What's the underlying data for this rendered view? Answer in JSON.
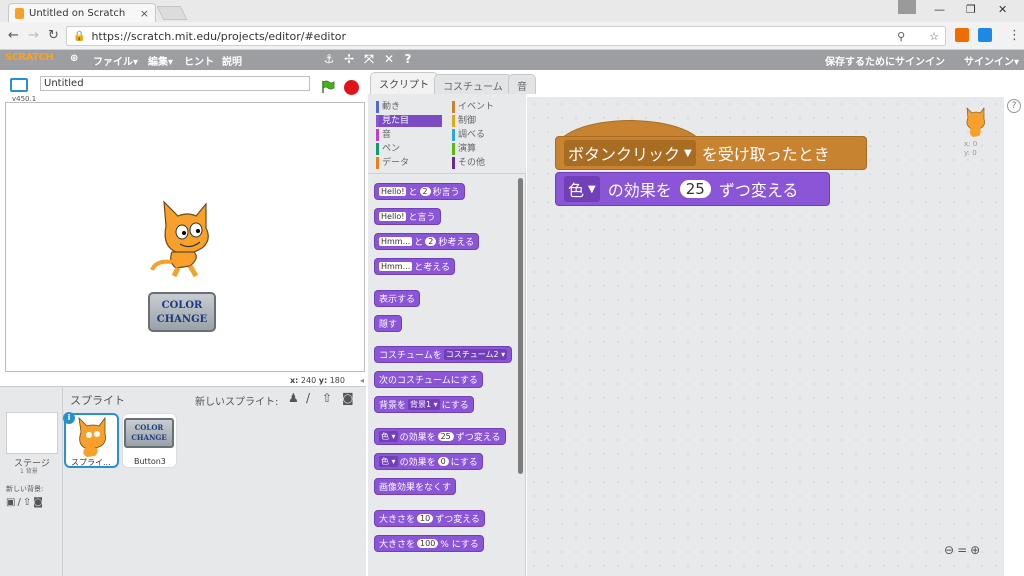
{
  "browser": {
    "tab_title": "Untitled on Scratch",
    "tab_close": "×",
    "url": "https://scratch.mit.edu/projects/editor/#editor",
    "window_controls": [
      "—",
      "❐",
      "✕"
    ]
  },
  "menubar": {
    "logo": "SCRATCH",
    "items": [
      "ファイル▾",
      "編集▾",
      "ヒント",
      "説明"
    ],
    "sign_in_to_save": "保存するためにサインイン",
    "sign_in": "サインイン▾"
  },
  "stage": {
    "version": "v450.1",
    "project_title": "Untitled",
    "coords_x_label": "x:",
    "coords_x": "240",
    "coords_y_label": "y:",
    "coords_y": "180",
    "button_text_line1": "COLOR",
    "button_text_line2": "CHANGE"
  },
  "sprites": {
    "title": "スプライト",
    "new_sprite": "新しいスプライト:",
    "stage_label": "ステージ",
    "stage_sub": "1 背景",
    "new_backdrop": "新しい背景:",
    "sprite1_name": "スプライ...",
    "button3_name": "Button3"
  },
  "tabs": {
    "scripts": "スクリプト",
    "costumes": "コスチューム",
    "sounds": "音"
  },
  "categories": [
    {
      "label": "動き",
      "color": "#4a6cd4"
    },
    {
      "label": "見た目",
      "color": "#8a55d7"
    },
    {
      "label": "音",
      "color": "#bb42c3"
    },
    {
      "label": "ペン",
      "color": "#0e9a6c"
    },
    {
      "label": "データ",
      "color": "#ee7d16"
    },
    {
      "label": "イベント",
      "color": "#c88330"
    },
    {
      "label": "制御",
      "color": "#e1a91a"
    },
    {
      "label": "調べる",
      "color": "#2ca5e2"
    },
    {
      "label": "演算",
      "color": "#5cb712"
    },
    {
      "label": "その他",
      "color": "#632d99"
    }
  ],
  "palette": {
    "say_secs": {
      "a": "Hello!",
      "b": "と",
      "c": "2",
      "d": "秒言う"
    },
    "say": {
      "a": "Hello!",
      "b": "と言う"
    },
    "think_secs": {
      "a": "Hmm...",
      "b": "と",
      "c": "2",
      "d": "秒考える"
    },
    "think": {
      "a": "Hmm...",
      "b": "と考える"
    },
    "show": "表示する",
    "hide": "隠す",
    "switch_costume": {
      "a": "コスチュームを",
      "b": "コスチューム2 ▾"
    },
    "next_costume": "次のコスチュームにする",
    "switch_backdrop": {
      "a": "背景を",
      "b": "背景1 ▾",
      "c": "にする"
    },
    "change_effect": {
      "a": "色 ▾",
      "b": "の効果を",
      "c": "25",
      "d": "ずつ変える"
    },
    "set_effect": {
      "a": "色 ▾",
      "b": "の効果を",
      "c": "0",
      "d": "にする"
    },
    "clear_effects": "画像効果をなくす",
    "change_size": {
      "a": "大きさを",
      "b": "10",
      "c": "ずつ変える"
    },
    "set_size": {
      "a": "大きさを",
      "b": "100",
      "c": "% にする"
    }
  },
  "script": {
    "hat_option": "ボタンクリック",
    "hat_text": "を受け取ったとき",
    "effect_option": "色",
    "effect_text_a": "の効果を",
    "effect_value": "25",
    "effect_text_b": "ずつ変える"
  },
  "script_area": {
    "sprite_x": "x: 0",
    "sprite_y": "y: 0"
  }
}
